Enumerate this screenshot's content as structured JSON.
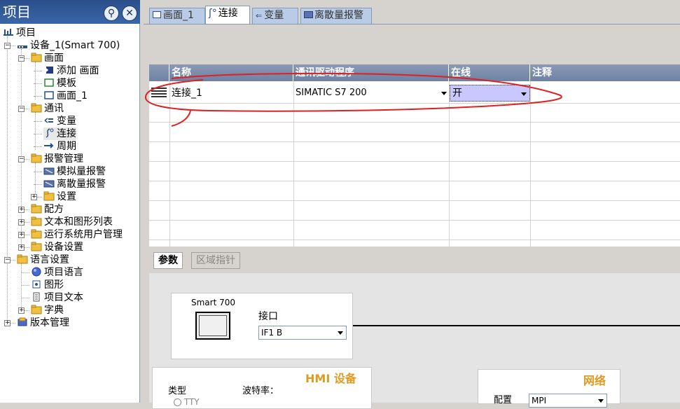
{
  "project_panel": {
    "title": "项目",
    "tree": [
      {
        "label": "项目"
      },
      {
        "label": "设备_1(Smart 700)"
      },
      {
        "label": "画面"
      },
      {
        "label": "添加 画面"
      },
      {
        "label": "模板"
      },
      {
        "label": "画面_1"
      },
      {
        "label": "通讯"
      },
      {
        "label": "变量"
      },
      {
        "label": "连接"
      },
      {
        "label": "周期"
      },
      {
        "label": "报警管理"
      },
      {
        "label": "模拟量报警"
      },
      {
        "label": "离散量报警"
      },
      {
        "label": "设置"
      },
      {
        "label": "配方"
      },
      {
        "label": "文本和图形列表"
      },
      {
        "label": "运行系统用户管理"
      },
      {
        "label": "设备设置"
      },
      {
        "label": "语言设置"
      },
      {
        "label": "项目语言"
      },
      {
        "label": "图形"
      },
      {
        "label": "项目文本"
      },
      {
        "label": "字典"
      },
      {
        "label": "版本管理"
      }
    ]
  },
  "tabs": [
    {
      "label": "画面_1"
    },
    {
      "label": "连接"
    },
    {
      "label": "变量"
    },
    {
      "label": "离散量报警"
    }
  ],
  "grid": {
    "columns": [
      "名称",
      "通讯驱动程序",
      "在线",
      "注释"
    ],
    "rows": [
      {
        "name": "连接_1",
        "driver": "SIMATIC S7 200",
        "online": "开",
        "comment": ""
      }
    ]
  },
  "subtabs": [
    "参数",
    "区域指针"
  ],
  "params": {
    "device_name": "Smart 700",
    "interface_label": "接口",
    "interface_value": "IF1 B",
    "hmi_title": "HMI 设备",
    "type_label": "类型",
    "baud_label": "波特率：",
    "type_option": "TTY",
    "network_title": "网络",
    "profile_label": "配置",
    "profile_value": "MPI"
  },
  "colors": {
    "header_blue": "#3a66a8",
    "accent_orange": "#e09a20",
    "selection": "#c8c8ff"
  }
}
